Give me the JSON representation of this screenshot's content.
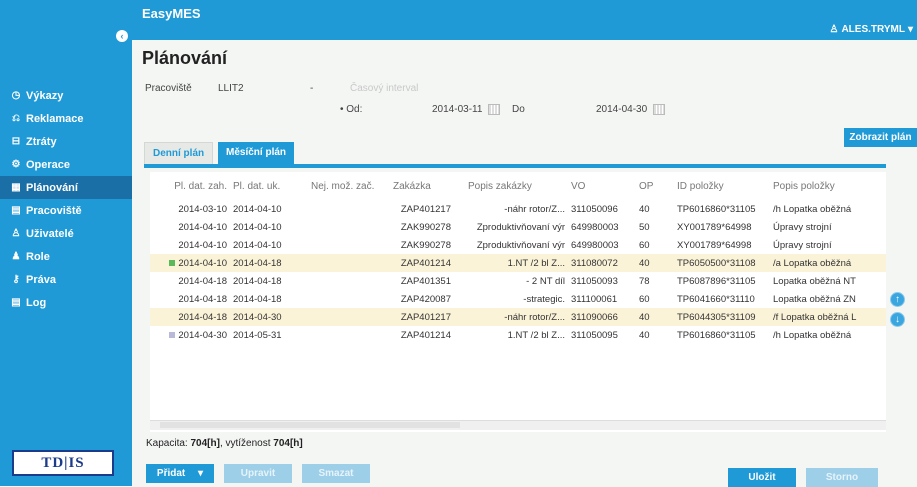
{
  "app": {
    "title": "EasyMES",
    "user": "ALES.TRYML",
    "logo_text": "TD|IS"
  },
  "sidebar": {
    "items": [
      {
        "label": "Výkazy",
        "icon": "clock-icon"
      },
      {
        "label": "Reklamace",
        "icon": "return-icon"
      },
      {
        "label": "Ztráty",
        "icon": "minus-box-icon"
      },
      {
        "label": "Operace",
        "icon": "gear-icon"
      },
      {
        "label": "Plánování",
        "icon": "calendar-icon",
        "active": true
      },
      {
        "label": "Pracoviště",
        "icon": "building-icon"
      },
      {
        "label": "Uživatelé",
        "icon": "user-icon"
      },
      {
        "label": "Role",
        "icon": "users-icon"
      },
      {
        "label": "Práva",
        "icon": "key-icon"
      },
      {
        "label": "Log",
        "icon": "log-icon"
      }
    ]
  },
  "page": {
    "title": "Plánování"
  },
  "filters": {
    "workplace_label": "Pracoviště",
    "workplace_value": "LLIT2",
    "dash": "-",
    "faint_label": "Časový interval",
    "od_label": "Od:",
    "od_value": "2014-03-11",
    "do_label": "Do",
    "do_value": "2014-04-30",
    "show_plan_button": "Zobrazit plán"
  },
  "tabs": {
    "daily": "Denní plán",
    "monthly": "Měsíční plán"
  },
  "table": {
    "columns": [
      "Pl. dat. zah.",
      "Pl. dat. uk.",
      "Nej. mož. zač.",
      "Zakázka",
      "Popis zakázky",
      "VO",
      "OP",
      "ID položky",
      "Popis položky"
    ],
    "rows": [
      [
        "2014-03-10",
        "2014-04-10",
        "",
        "ZAP401217",
        "-náhr rotor/Z...",
        "311050096",
        "40",
        "TP6016860*31105",
        "/h Lopatka oběžná"
      ],
      [
        "2014-04-10",
        "2014-04-10",
        "",
        "ZAK990278",
        "Zproduktivňovaní výr",
        "649980003",
        "50",
        "XY001789*64998",
        "Úpravy strojní"
      ],
      [
        "2014-04-10",
        "2014-04-10",
        "",
        "ZAK990278",
        "Zproduktivňovaní výr",
        "649980003",
        "60",
        "XY001789*64998",
        "Úpravy strojní"
      ],
      [
        "2014-04-10",
        "2014-04-18",
        "",
        "ZAP401214",
        "1.NT /2 bl Z...",
        "311080072",
        "40",
        "TP6050500*31108",
        "/a Lopatka oběžná"
      ],
      [
        "2014-04-18",
        "2014-04-18",
        "",
        "ZAP401351",
        "- 2 NT díl",
        "311050093",
        "78",
        "TP6087896*31105",
        "Lopatka oběžná NT"
      ],
      [
        "2014-04-18",
        "2014-04-18",
        "",
        "ZAP420087",
        "-strategic.",
        "311100061",
        "60",
        "TP6041660*31110",
        "Lopatka oběžná ZN"
      ],
      [
        "2014-04-18",
        "2014-04-30",
        "",
        "ZAP401217",
        "-náhr rotor/Z...",
        "311090066",
        "40",
        "TP6044305*31109",
        "/f Lopatka oběžná L"
      ],
      [
        "2014-04-30",
        "2014-05-31",
        "",
        "ZAP401214",
        "1.NT /2 bl Z...",
        "311050095",
        "40",
        "TP6016860*31105",
        "/h Lopatka oběžná"
      ]
    ],
    "row_markers": [
      "",
      "",
      "",
      "green",
      "",
      "",
      "",
      "gray"
    ],
    "selected_rows": [
      3,
      6
    ]
  },
  "capacity": {
    "label": "Kapacita:",
    "value": "704[h]",
    "util_label": ", vytíženost",
    "util_value": "704[h]"
  },
  "buttons": {
    "add": "Přidat",
    "edit": "Upravit",
    "delete": "Smazat",
    "save": "Uložit",
    "cancel": "Storno"
  },
  "colors": {
    "accent": "#1f9ad6",
    "active_menu": "#1a6fa6",
    "selected_row": "#fbf3d8",
    "marker_green": "#5cb85c",
    "marker_gray": "#b9b9d8"
  }
}
